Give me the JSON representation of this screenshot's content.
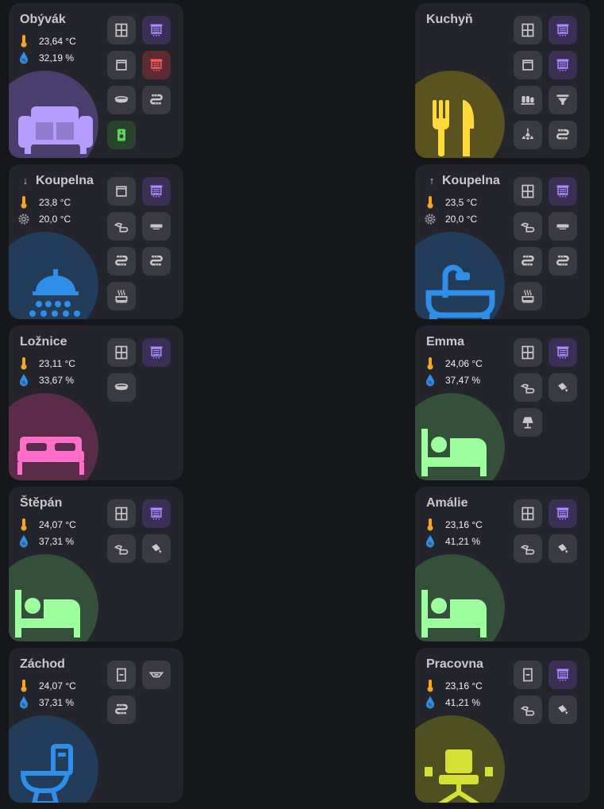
{
  "colors": {
    "background": "#16171b",
    "card": "#24252c",
    "button": "#3a3b42",
    "temp_icon": "#f5a623",
    "humidity_icon": "#2f8fe8",
    "setpoint_icon": "#9a9a9a"
  },
  "rooms": [
    {
      "name": "Obývák",
      "arrow": "",
      "stat1": "23,64 °C",
      "stat1_kind": "temperature",
      "stat2": "32,19 %",
      "stat2_kind": "humidity",
      "icon": "sofa-icon",
      "accent": "#b79cff",
      "blob": "#4a3e6d",
      "buttons": [
        {
          "icon": "window-icon",
          "state": "normal"
        },
        {
          "icon": "blind-icon",
          "state": "purple"
        },
        {
          "icon": "window-single-icon",
          "state": "normal"
        },
        {
          "icon": "blind-icon",
          "state": "red"
        },
        {
          "icon": "ceiling-light-icon",
          "state": "normal"
        },
        {
          "icon": "led-strip-icon",
          "state": "normal"
        },
        {
          "icon": "speaker-icon",
          "state": "green"
        }
      ]
    },
    {
      "name": "Kuchyň",
      "arrow": "",
      "stat1": "",
      "stat1_kind": "",
      "stat2": "",
      "stat2_kind": "",
      "icon": "fork-knife-icon",
      "accent": "#ffd83a",
      "blob": "#5a5320",
      "buttons": [
        {
          "icon": "window-icon",
          "state": "normal"
        },
        {
          "icon": "blind-icon",
          "state": "purple"
        },
        {
          "icon": "window-single-icon",
          "state": "normal"
        },
        {
          "icon": "blind-icon",
          "state": "purple"
        },
        {
          "icon": "light-bars-icon",
          "state": "normal"
        },
        {
          "icon": "funnel-light-icon",
          "state": "normal"
        },
        {
          "icon": "chandelier-icon",
          "state": "normal"
        },
        {
          "icon": "led-strip-icon",
          "state": "normal"
        }
      ]
    },
    {
      "name": "Koupelna",
      "arrow": "↓",
      "stat1": "23,8 °C",
      "stat1_kind": "temperature",
      "stat2": "20,0 °C",
      "stat2_kind": "setpoint",
      "icon": "shower-icon",
      "accent": "#2f8fe8",
      "blob": "#233c5a",
      "buttons": [
        {
          "icon": "window-single-icon",
          "state": "normal"
        },
        {
          "icon": "blind-icon",
          "state": "purple"
        },
        {
          "icon": "lamp-tilt-icon",
          "state": "normal"
        },
        {
          "icon": "wall-light-icon",
          "state": "normal"
        },
        {
          "icon": "led-strip-icon",
          "state": "normal"
        },
        {
          "icon": "led-strip-icon",
          "state": "normal"
        },
        {
          "icon": "heater-icon",
          "state": "normal"
        }
      ]
    },
    {
      "name": "Koupelna",
      "arrow": "↑",
      "stat1": "23,5 °C",
      "stat1_kind": "temperature",
      "stat2": "20,0 °C",
      "stat2_kind": "setpoint",
      "icon": "bathtub-icon",
      "accent": "#2f8fe8",
      "blob": "#233c5a",
      "buttons": [
        {
          "icon": "window-icon",
          "state": "normal"
        },
        {
          "icon": "blind-icon",
          "state": "purple"
        },
        {
          "icon": "lamp-tilt-icon",
          "state": "normal"
        },
        {
          "icon": "wall-light-icon",
          "state": "normal"
        },
        {
          "icon": "led-strip-icon",
          "state": "normal"
        },
        {
          "icon": "led-strip-icon",
          "state": "normal"
        },
        {
          "icon": "heater-icon",
          "state": "normal"
        }
      ]
    },
    {
      "name": "Ložnice",
      "arrow": "",
      "stat1": "23,11 °C",
      "stat1_kind": "temperature",
      "stat2": "33,67 %",
      "stat2_kind": "humidity",
      "icon": "double-bed-icon",
      "accent": "#ff6ec7",
      "blob": "#5a2c4a",
      "buttons": [
        {
          "icon": "window-icon",
          "state": "normal"
        },
        {
          "icon": "blind-icon",
          "state": "purple"
        },
        {
          "icon": "ceiling-light-icon",
          "state": "normal"
        }
      ]
    },
    {
      "name": "Emma",
      "arrow": "",
      "stat1": "24,06 °C",
      "stat1_kind": "temperature",
      "stat2": "37,47 %",
      "stat2_kind": "humidity",
      "icon": "bed-person-icon",
      "accent": "#9dff9d",
      "blob": "#34503a",
      "buttons": [
        {
          "icon": "window-icon",
          "state": "normal"
        },
        {
          "icon": "blind-icon",
          "state": "purple"
        },
        {
          "icon": "lamp-tilt-icon",
          "state": "normal"
        },
        {
          "icon": "spotlight-icon",
          "state": "normal"
        },
        {
          "icon": "table-lamp-icon",
          "state": "normal"
        }
      ]
    },
    {
      "name": "Štěpán",
      "arrow": "",
      "stat1": "24,07 °C",
      "stat1_kind": "temperature",
      "stat2": "37,31 %",
      "stat2_kind": "humidity",
      "icon": "bed-person-icon",
      "accent": "#9dff9d",
      "blob": "#34503a",
      "buttons": [
        {
          "icon": "window-icon",
          "state": "normal"
        },
        {
          "icon": "blind-icon",
          "state": "purple"
        },
        {
          "icon": "lamp-tilt-icon",
          "state": "normal"
        },
        {
          "icon": "spotlight-icon",
          "state": "normal"
        }
      ]
    },
    {
      "name": "Amálie",
      "arrow": "",
      "stat1": "23,16 °C",
      "stat1_kind": "temperature",
      "stat2": "41,21 %",
      "stat2_kind": "humidity",
      "icon": "bed-person-icon",
      "accent": "#9dff9d",
      "blob": "#34503a",
      "buttons": [
        {
          "icon": "window-icon",
          "state": "normal"
        },
        {
          "icon": "blind-icon",
          "state": "purple"
        },
        {
          "icon": "lamp-tilt-icon",
          "state": "normal"
        },
        {
          "icon": "spotlight-icon",
          "state": "normal"
        }
      ]
    },
    {
      "name": "Záchod",
      "arrow": "",
      "stat1": "24,07 °C",
      "stat1_kind": "temperature",
      "stat2": "37,31 %",
      "stat2_kind": "humidity",
      "icon": "toilet-icon",
      "accent": "#2f8fe8",
      "blob": "#233c5a",
      "buttons": [
        {
          "icon": "door-icon",
          "state": "normal"
        },
        {
          "icon": "ceiling-flat-light-icon",
          "state": "normal"
        },
        {
          "icon": "led-strip-icon",
          "state": "normal"
        }
      ]
    },
    {
      "name": "Pracovna",
      "arrow": "",
      "stat1": "23,16 °C",
      "stat1_kind": "temperature",
      "stat2": "41,21 %",
      "stat2_kind": "humidity",
      "icon": "office-chair-icon",
      "accent": "#d4e034",
      "blob": "#4e5022",
      "buttons": [
        {
          "icon": "door-icon",
          "state": "normal"
        },
        {
          "icon": "blind-icon",
          "state": "purple"
        },
        {
          "icon": "lamp-tilt-icon",
          "state": "normal"
        },
        {
          "icon": "spotlight-icon",
          "state": "normal"
        }
      ]
    }
  ]
}
